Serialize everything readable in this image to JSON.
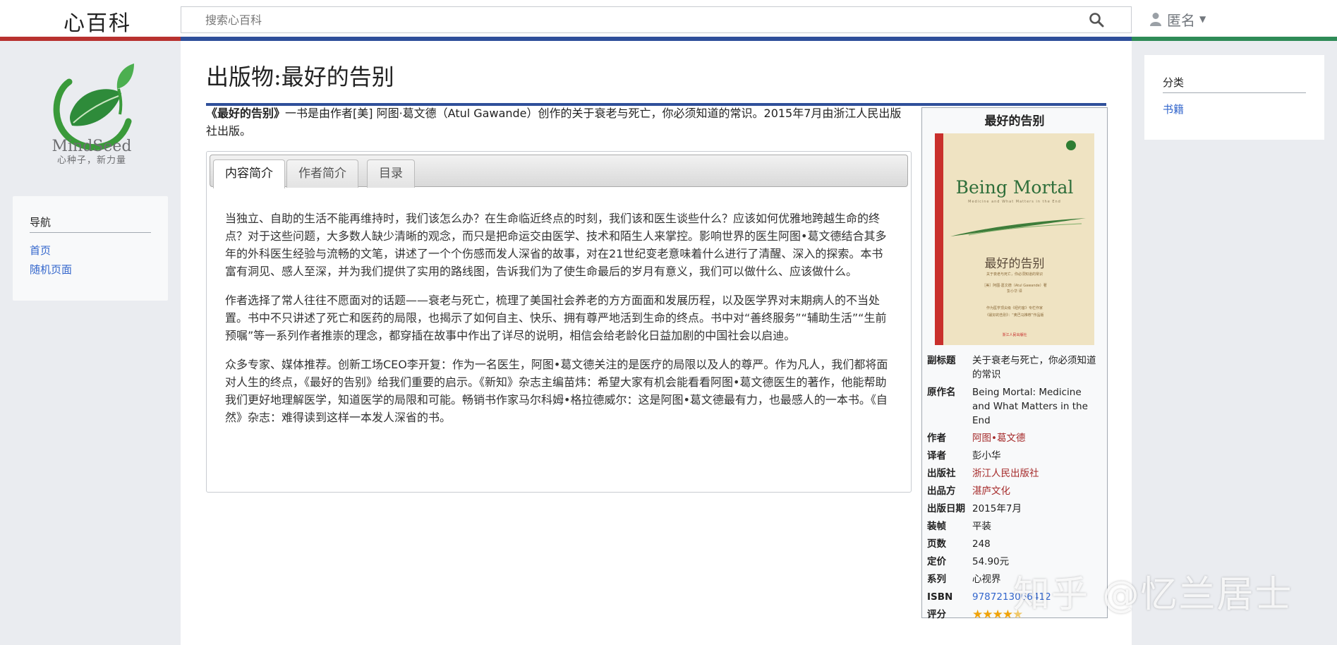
{
  "header": {
    "site_title": "心百科",
    "search_placeholder": "搜索心百科",
    "user_label": "匿名"
  },
  "logo": {
    "brand": "MindSeed",
    "slogan": "心种子，新力量"
  },
  "nav": {
    "heading": "导航",
    "items": [
      {
        "label": "首页"
      },
      {
        "label": "随机页面"
      }
    ]
  },
  "categories": {
    "heading": "分类",
    "items": [
      {
        "label": "书籍"
      }
    ]
  },
  "page": {
    "title": "出版物:最好的告别",
    "lead_bold": "《最好的告别》",
    "lead_rest": "一书是由作者[美] 阿图·葛文德（Atul Gawande）创作的关于衰老与死亡，你必须知道的常识。2015年7月由浙江人民出版社出版。"
  },
  "tabs": [
    {
      "label": "内容简介"
    },
    {
      "label": "作者简介"
    },
    {
      "label": "目录"
    }
  ],
  "tab_content": {
    "paragraphs": [
      "当独立、自助的生活不能再维持时，我们该怎么办？在生命临近终点的时刻，我们该和医生谈些什么？应该如何优雅地跨越生命的终点？对于这些问题，大多数人缺少清晰的观念，而只是把命运交由医学、技术和陌生人来掌控。影响世界的医生阿图•葛文德结合其多年的外科医生经验与流畅的文笔，讲述了一个个伤感而发人深省的故事，对在21世纪变老意味着什么进行了清醒、深入的探索。本书富有洞见、感人至深，并为我们提供了实用的路线图，告诉我们为了使生命最后的岁月有意义，我们可以做什么、应该做什么。",
      "作者选择了常人往往不愿面对的话题——衰老与死亡，梳理了美国社会养老的方方面面和发展历程，以及医学界对末期病人的不当处置。书中不只讲述了死亡和医药的局限，也揭示了如何自主、快乐、拥有尊严地活到生命的终点。书中对“善终服务”“辅助生活”“生前预嘱”等一系列作者推崇的理念，都穿插在故事中作出了详尽的说明，相信会给老龄化日益加剧的中国社会以启迪。",
      "众多专家、媒体推荐。创新工场CEO李开复：作为一名医生，阿图•葛文德关注的是医疗的局限以及人的尊严。作为凡人，我们都将面对人生的终点，《最好的告别》给我们重要的启示。《新知》杂志主编苗炜：希望大家有机会能看看阿图•葛文德医生的著作，他能帮助我们更好地理解医学，知道医学的局限和可能。畅销书作家马尔科姆•格拉德威尔：这是阿图•葛文德最有力，也最感人的一本书。《自然》杂志：难得读到这样一本发人深省的书。"
    ]
  },
  "infobox": {
    "title": "最好的告别",
    "cover": {
      "en_title": "Being Mortal",
      "en_subtitle": "Medicine and What Matters in the End",
      "cn_title": "最好的告别",
      "cn_subtitle": "关于衰老与死亡，你必须知道的常识",
      "author_line": "［美］阿图·葛文德（Atul Gawande）著",
      "translator_line": "彭小华 译",
      "blurb1": "作为医学顶尖级《纽约客》专栏作家",
      "blurb2": "《最好的告别》：“奥巴马推荐”作品版",
      "publisher": "浙江人民出版社"
    },
    "rows": [
      {
        "label": "副标题",
        "value": "关于衰老与死亡，你必须知道的常识",
        "link": false
      },
      {
        "label": "原作名",
        "value": "Being Mortal: Medicine and What Matters in the End",
        "link": false
      },
      {
        "label": "作者",
        "value": "阿图•葛文德",
        "link": true
      },
      {
        "label": "译者",
        "value": "彭小华",
        "link": false
      },
      {
        "label": "出版社",
        "value": "浙江人民出版社",
        "link": true
      },
      {
        "label": "出品方",
        "value": "湛庐文化",
        "link": true
      },
      {
        "label": "出版日期",
        "value": "2015年7月",
        "link": false
      },
      {
        "label": "装帧",
        "value": "平装",
        "link": false
      },
      {
        "label": "页数",
        "value": "248",
        "link": false
      },
      {
        "label": "定价",
        "value": "54.90元",
        "link": false
      },
      {
        "label": "系列",
        "value": "心视界",
        "link": false
      },
      {
        "label": "ISBN",
        "value": "9787213066412",
        "link": true
      }
    ],
    "rating_label": "评分",
    "rating_stars": 4.5,
    "rating_max": 5
  },
  "watermark": "知乎 @忆兰居士",
  "colors": {
    "accent_blue": "#2f4f9a",
    "stripe_red": "#b8312f",
    "stripe_green": "#2e8b57",
    "link_blue": "#3366cc",
    "link_red": "#a52a2a",
    "star": "#f0a30a"
  },
  "icons": {
    "search": "search-icon",
    "user": "user-icon",
    "caret": "caret-down-icon"
  }
}
